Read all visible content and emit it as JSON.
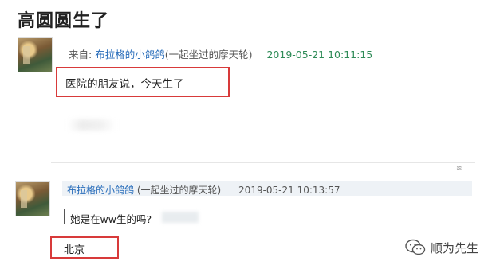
{
  "page": {
    "title": "高圆圆生了"
  },
  "post1": {
    "from_label": "来自:",
    "author": "布拉格的小鸽鸽",
    "author_paren": "(一起坐过的摩天轮)",
    "timestamp": "2019-05-21 10:11:15",
    "content": "医院的朋友说，今天生了"
  },
  "post2": {
    "author": "布拉格的小鸽鸽",
    "author_paren": "(一起坐过的摩天轮)",
    "timestamp": "2019-05-21 10:13:57",
    "quote": "她是在ww生的吗?",
    "answer": "北京"
  },
  "watermark": {
    "text": "顺为先生",
    "icon": "wechat-icon"
  },
  "colors": {
    "highlight_box": "#d83a3a",
    "author_link": "#2a6ebb",
    "timestamp_green": "#2e8b57"
  }
}
